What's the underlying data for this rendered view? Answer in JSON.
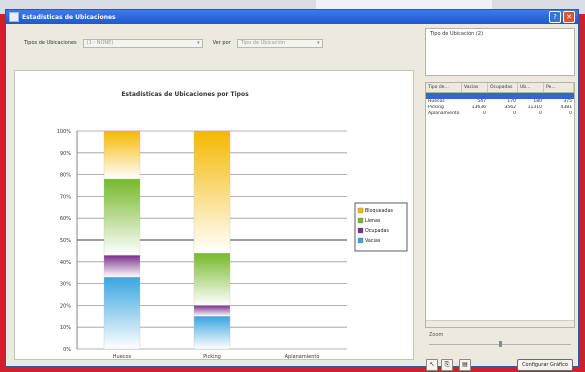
{
  "window": {
    "title": "Estadísticas de Ubicaciones"
  },
  "filters": {
    "tipo_label": "Tipos de Ubicaciones",
    "tipo_value": "(1 - NONE)",
    "ver_label": "Ver por",
    "ver_value": "Tipo de Ubicación"
  },
  "type_box": {
    "text": "Tipo de Ubicación (2)"
  },
  "grid": {
    "columns": [
      "Tipo de...",
      "Vacías",
      "Ocupadas",
      "Ub...",
      "Pe..."
    ],
    "rows": [
      [
        "",
        "",
        "",
        "",
        ""
      ],
      [
        "Huecos",
        "547",
        "170",
        "180",
        "375"
      ],
      [
        "Picking",
        "13636",
        "3562",
        "11310",
        "4381"
      ],
      [
        "Aplanamiento",
        "0",
        "0",
        "0",
        "0"
      ]
    ]
  },
  "zoom": {
    "label": "Zoom",
    "position": 0.5
  },
  "buttons": {
    "configure": "Configurar Gráfico"
  },
  "chart_data": {
    "type": "bar",
    "stacked": true,
    "title": "Estadísticas de Ubicaciones por Tipos",
    "categories": [
      "Huecos",
      "Picking",
      "Aplanamiento"
    ],
    "ylim": [
      0,
      100
    ],
    "yticks": [
      "0%",
      "10%",
      "20%",
      "30%",
      "40%",
      "50%",
      "60%",
      "70%",
      "80%",
      "90%",
      "100%"
    ],
    "series": [
      {
        "name": "Vacias",
        "color": "#3aa5e0",
        "values": [
          33,
          15,
          0
        ]
      },
      {
        "name": "Ocupadas",
        "color": "#7a2e8a",
        "values": [
          10,
          5,
          0
        ]
      },
      {
        "name": "Llenas",
        "color": "#76b82a",
        "values": [
          35,
          24,
          0
        ]
      },
      {
        "name": "Bloqueadas",
        "color": "#f5b800",
        "values": [
          22,
          56,
          0
        ]
      }
    ],
    "legend": [
      "Bloqueadas",
      "Llenas",
      "Ocupadas",
      "Vacias"
    ],
    "legend_position": "right"
  }
}
